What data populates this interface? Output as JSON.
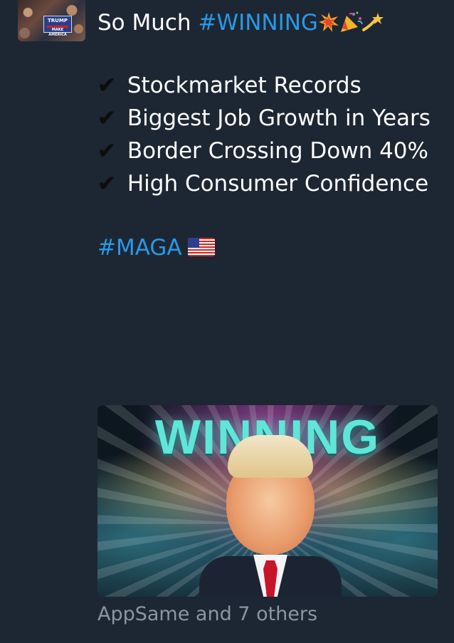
{
  "author": {
    "avatar_sign_text": "TRUMP",
    "avatar_sign_subtext": "MAKE AMERICA"
  },
  "post": {
    "title_prefix": "So Much",
    "title_hashtag": "#WINNING",
    "title_emojis": [
      "collision-emoji",
      "party-popper-emoji",
      "dizzy-emoji"
    ],
    "checkmark": "✔",
    "items": [
      "Stockmarket Records",
      "Biggest Job Growth in Years",
      "Border Crossing Down 40%",
      "High Consumer Confidence"
    ],
    "footer_hashtag": "#MAGA",
    "footer_emoji": "us-flag-emoji"
  },
  "media": {
    "word": "WINNING",
    "description_colors": [
      "#5fe6d8",
      "#dc50c8",
      "#f0aa3c"
    ]
  },
  "reactions": {
    "likes_text": "AppSame and 7 others"
  },
  "colors": {
    "background": "#1d2733",
    "hashtag": "#2a98e8",
    "muted_text": "#8b96a3"
  }
}
